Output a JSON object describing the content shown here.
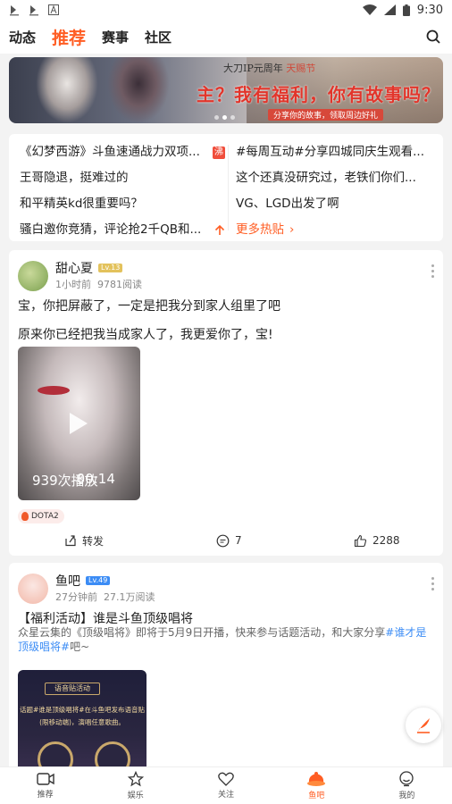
{
  "status_bar": {
    "app_icons": [
      "app-icon-1",
      "app-icon-2",
      "a-icon"
    ],
    "time": "9:30",
    "icons": [
      "wifi-icon",
      "signal-icon",
      "battery-icon"
    ]
  },
  "top_nav": {
    "tabs": [
      {
        "label": "动态",
        "active": false
      },
      {
        "label": "推荐",
        "active": true
      },
      {
        "label": "赛事",
        "active": false
      },
      {
        "label": "社区",
        "active": false
      }
    ],
    "search_icon": "search-icon"
  },
  "banner": {
    "top_text": "大刀IP元周年",
    "top_highlight": "天赐节",
    "main_text": "主？我有福利，你有故事吗？",
    "sub_text": "分享你的故事，领取周边好礼"
  },
  "hot_topics": {
    "left": [
      {
        "text": "《幻梦西游》斗鱼速通战力双项..."
      },
      {
        "text": "王哥隐退，挺难过的"
      },
      {
        "text": "和平精英kd很重要吗？"
      },
      {
        "text": "骚白邀你竞猜，评论抢2千QB和..."
      }
    ],
    "right": [
      {
        "text": "#每周互动#分享四城同庆生观看..."
      },
      {
        "text": "这个还真没研究过，老铁们你们..."
      },
      {
        "text": "VG、LGD出发了啊"
      },
      {
        "text": "更多热贴"
      }
    ],
    "hot_badge": "沸",
    "more_arrow": "›"
  },
  "post1": {
    "author": "甜心夏",
    "level": "Lv.13",
    "time": "1小时前",
    "views": "9781阅读",
    "line1": "宝，你把屏蔽了，一定是把我分到家人组里了吧",
    "line2": "原来你已经把我当成家人了，我更爱你了，宝!",
    "video_plays": "939次播放",
    "video_duration": "00:14",
    "tag": "DOTA2",
    "share_label": "转发",
    "comments": "7",
    "likes": "2288"
  },
  "post2": {
    "author": "鱼吧",
    "level": "Lv.49",
    "time": "27分钟前",
    "views": "27.1万阅读",
    "title": "【福利活动】谁是斗鱼顶级唱将",
    "desc_prefix": "众星云集的《顶级唱将》即将于5月9日开播，快来参与话题活动，和大家分享",
    "desc_topic": "#谁才是顶级唱将#",
    "desc_suffix": "吧~",
    "event_label": "语音贴活动",
    "event_text": "话题#谁是顶级唱将#在斗鱼吧发布语音贴\n(限移动端)，演唱任意歌曲。"
  },
  "bottom_nav": [
    {
      "label": "推荐",
      "icon": "video-icon",
      "active": false
    },
    {
      "label": "娱乐",
      "icon": "star-icon",
      "active": false
    },
    {
      "label": "关注",
      "icon": "heart-icon",
      "active": false
    },
    {
      "label": "鱼吧",
      "icon": "fishbar-icon",
      "active": true
    },
    {
      "label": "我的",
      "icon": "profile-icon",
      "active": false
    }
  ],
  "colors": {
    "accent": "#ff5d23",
    "topic_blue": "#3b8cf5"
  }
}
